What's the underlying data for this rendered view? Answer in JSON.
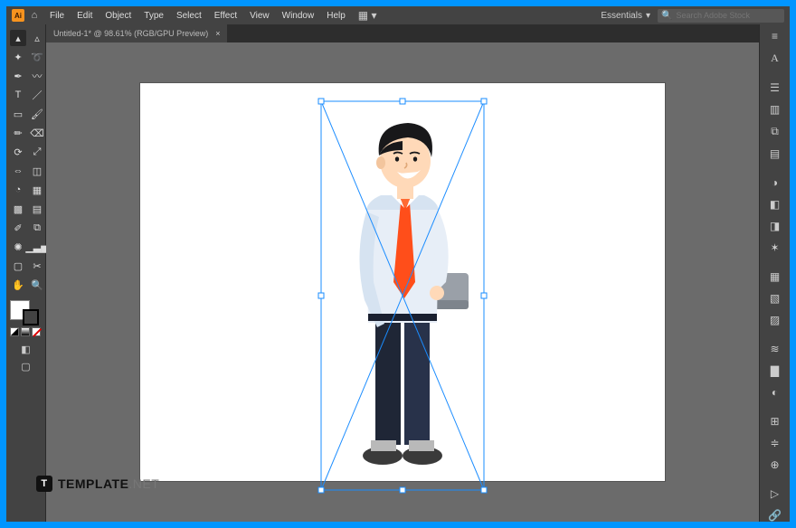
{
  "menu": {
    "items": [
      "File",
      "Edit",
      "Object",
      "Type",
      "Select",
      "Effect",
      "View",
      "Window",
      "Help"
    ]
  },
  "workspace": {
    "label": "Essentials"
  },
  "search": {
    "placeholder": "Search Adobe Stock"
  },
  "tab": {
    "title": "Untitled-1* @ 98.61% (RGB/GPU Preview)",
    "close": "×"
  },
  "tools": {
    "left": [
      "selection-tool",
      "direct-selection-tool",
      "magic-wand-tool",
      "lasso-tool",
      "pen-tool",
      "curvature-tool",
      "type-tool",
      "line-segment-tool",
      "rectangle-tool",
      "paintbrush-tool",
      "shaper-tool",
      "eraser-tool",
      "rotate-tool",
      "scale-tool",
      "width-tool",
      "free-transform-tool",
      "shape-builder-tool",
      "perspective-grid-tool",
      "mesh-tool",
      "gradient-tool",
      "eyedropper-tool",
      "blend-tool",
      "symbol-sprayer-tool",
      "column-graph-tool",
      "artboard-tool",
      "slice-tool",
      "hand-tool",
      "zoom-tool"
    ],
    "right": [
      "properties-panel",
      "color-panel",
      "swatches-panel",
      "brushes-panel",
      "symbols-panel",
      "stroke-panel",
      "gradient-panel",
      "transparency-panel",
      "appearance-panel",
      "graphic-styles-panel",
      "layers-panel",
      "asset-export-panel",
      "artboards-panel",
      "libraries-panel",
      "transform-panel",
      "align-panel",
      "pathfinder-panel",
      "actions-panel",
      "links-panel",
      "css-properel"
    ]
  },
  "watermark": {
    "brand": "TEMPLATE",
    "suffix": ".NET",
    "badge": "T"
  },
  "artwork": {
    "description": "businessman-illustration-selected",
    "selection_handles": 8
  }
}
